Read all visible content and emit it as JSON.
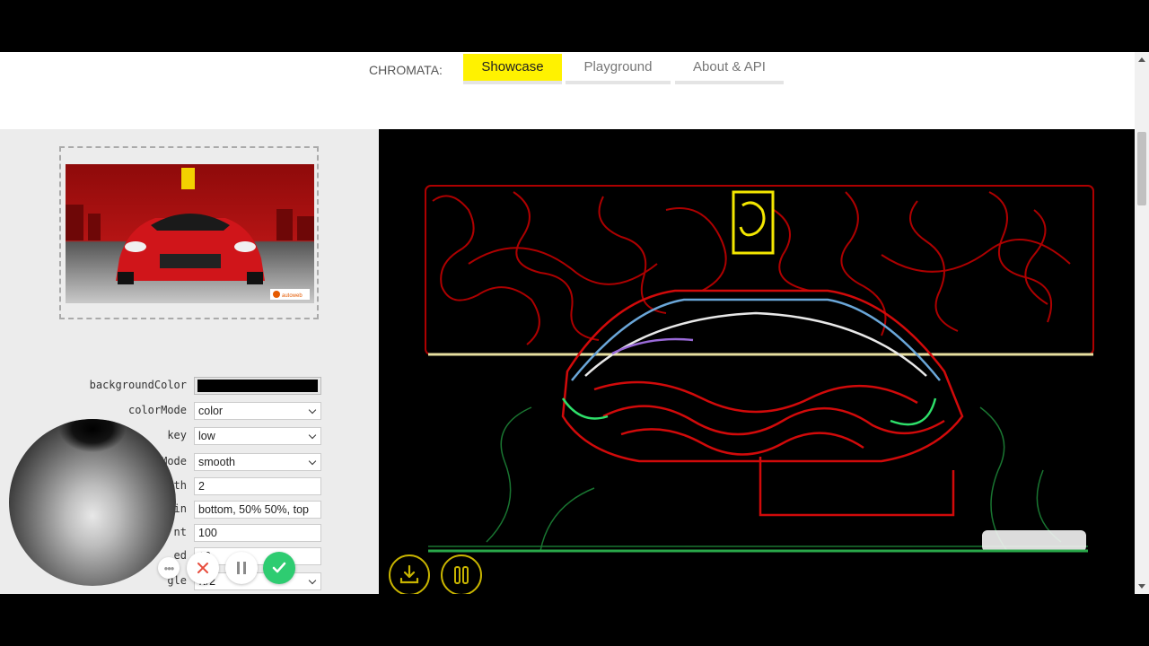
{
  "nav": {
    "brand": "CHROMATA:",
    "tabs": [
      {
        "label": "Showcase",
        "active": true
      },
      {
        "label": "Playground",
        "active": false
      },
      {
        "label": "About & API",
        "active": false
      }
    ]
  },
  "source_image": {
    "badge_text": "autoweb"
  },
  "settings": {
    "backgroundColor": {
      "label": "backgroundColor",
      "value": "#000000"
    },
    "colorMode": {
      "label": "colorMode",
      "value": "color"
    },
    "key": {
      "label": "key",
      "value": "low"
    },
    "lineMode": {
      "label": "lineMode",
      "value": "smooth"
    },
    "lineWidth": {
      "label": "ineWidth",
      "value": "2"
    },
    "origin": {
      "label": "igin",
      "value": "bottom, 50% 50%, top"
    },
    "pathFinderCount": {
      "label": "nt",
      "value": "100"
    },
    "speed": {
      "label": "ed",
      "value": "10"
    },
    "turningAngle": {
      "label": "gle",
      "value": "π/2"
    }
  },
  "actions": {
    "more": "more-icon",
    "cancel": "close-icon",
    "pause": "pause-icon",
    "confirm": "check-icon"
  },
  "canvas_controls": {
    "download": "download-icon",
    "pause": "pause-icon"
  },
  "colors": {
    "accent": "#fff200",
    "confirm": "#2ecc71",
    "cancel": "#e74c3c",
    "canvas_bg": "#000000",
    "panel_bg": "#ececec"
  }
}
